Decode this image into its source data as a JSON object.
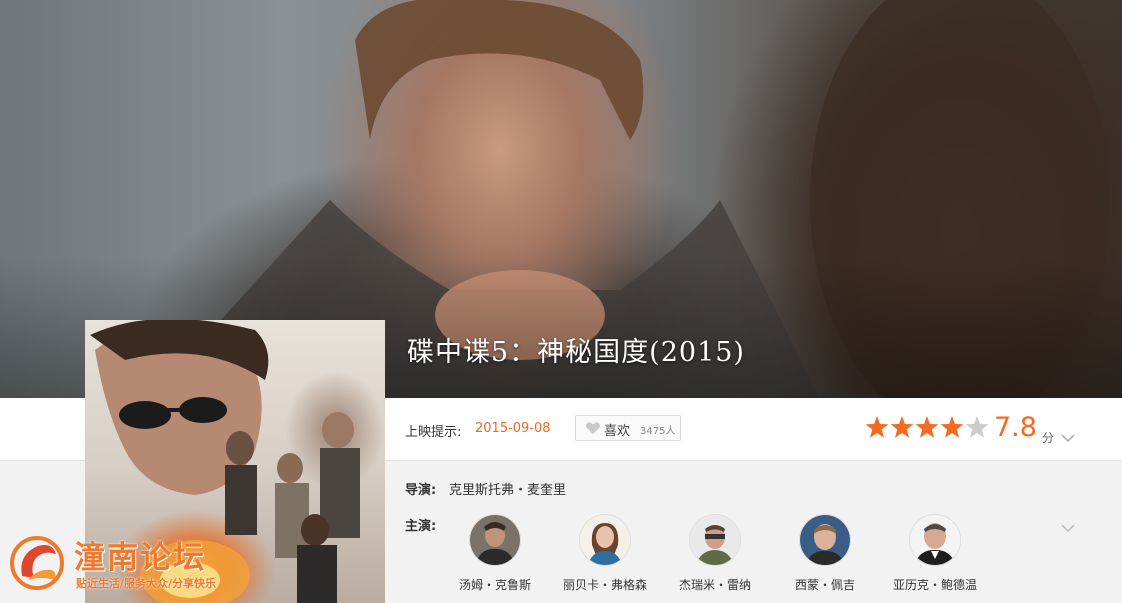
{
  "movie": {
    "title": "碟中谍5：神秘国度(2015)",
    "release_label": "上映提示:",
    "release_date": "2015-09-08",
    "like_label": "喜欢",
    "like_count": "3475人",
    "rating": {
      "stars_filled": 4,
      "stars_total": 5,
      "score": "7.8",
      "unit": "分"
    }
  },
  "credits": {
    "director_label": "导演:",
    "director": "克里斯托弗・麦奎里",
    "cast_label": "主演:",
    "cast": [
      {
        "name": "汤姆・克鲁斯"
      },
      {
        "name": "丽贝卡・弗格森"
      },
      {
        "name": "杰瑞米・雷纳"
      },
      {
        "name": "西蒙・佩吉"
      },
      {
        "name": "亚历克・鲍德温"
      }
    ]
  },
  "watermark": {
    "title": "潼南论坛",
    "subtitle": "贴近生活/服务大众/分享快乐"
  },
  "colors": {
    "accent": "#f26b21",
    "date": "#e66a2c",
    "star_on": "#f26b21",
    "star_off": "#cccccc"
  },
  "icons": [
    "heart-icon",
    "star-icon",
    "chevron-down-icon",
    "forum-logo-icon"
  ]
}
